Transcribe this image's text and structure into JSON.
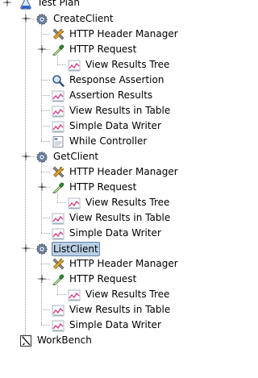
{
  "tree": {
    "root": "Test Plan",
    "nodes": [
      {
        "depth": 1,
        "label": "CreateClient",
        "icon": "thread-group-gear-icon",
        "expand": "collapse-handle-icon"
      },
      {
        "depth": 2,
        "label": "HTTP Header Manager",
        "icon": "tools-config-icon"
      },
      {
        "depth": 2,
        "label": "HTTP Request",
        "icon": "pipette-sampler-icon",
        "expand": "collapse-handle-icon"
      },
      {
        "depth": 3,
        "label": "View Results Tree",
        "icon": "graph-listener-icon"
      },
      {
        "depth": 2,
        "label": "Response Assertion",
        "icon": "magnifier-assertion-icon"
      },
      {
        "depth": 2,
        "label": "Assertion Results",
        "icon": "graph-listener-icon"
      },
      {
        "depth": 2,
        "label": "View Results in Table",
        "icon": "graph-listener-icon"
      },
      {
        "depth": 2,
        "label": "Simple Data Writer",
        "icon": "graph-listener-icon"
      },
      {
        "depth": 2,
        "label": "While Controller",
        "icon": "document-controller-icon"
      },
      {
        "depth": 1,
        "label": "GetClient",
        "icon": "thread-group-gear-icon",
        "expand": "collapse-handle-icon"
      },
      {
        "depth": 2,
        "label": "HTTP Header Manager",
        "icon": "tools-config-icon"
      },
      {
        "depth": 2,
        "label": "HTTP Request",
        "icon": "pipette-sampler-icon",
        "expand": "collapse-handle-icon"
      },
      {
        "depth": 3,
        "label": "View Results Tree",
        "icon": "graph-listener-icon"
      },
      {
        "depth": 2,
        "label": "View Results in Table",
        "icon": "graph-listener-icon"
      },
      {
        "depth": 2,
        "label": "Simple Data Writer",
        "icon": "graph-listener-icon"
      },
      {
        "depth": 1,
        "label": "ListClient",
        "icon": "thread-group-gear-icon",
        "expand": "collapse-handle-icon",
        "selected": true
      },
      {
        "depth": 2,
        "label": "HTTP Header Manager",
        "icon": "tools-config-icon"
      },
      {
        "depth": 2,
        "label": "HTTP Request",
        "icon": "pipette-sampler-icon",
        "expand": "collapse-handle-icon"
      },
      {
        "depth": 3,
        "label": "View Results Tree",
        "icon": "graph-listener-icon"
      },
      {
        "depth": 2,
        "label": "View Results in Table",
        "icon": "graph-listener-icon"
      },
      {
        "depth": 2,
        "label": "Simple Data Writer",
        "icon": "graph-listener-icon"
      },
      {
        "depth": 0,
        "label": "WorkBench",
        "icon": "workbench-icon"
      }
    ]
  },
  "colors": {
    "selection_background": "#b8cfe5",
    "selection_border": "#6382a8",
    "tree_line": "#a0a0a0"
  }
}
